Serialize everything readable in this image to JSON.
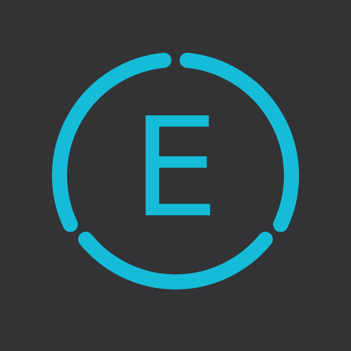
{
  "icon": {
    "letter": "E",
    "accent_color": "#15bcd8",
    "background_color": "#333336"
  }
}
